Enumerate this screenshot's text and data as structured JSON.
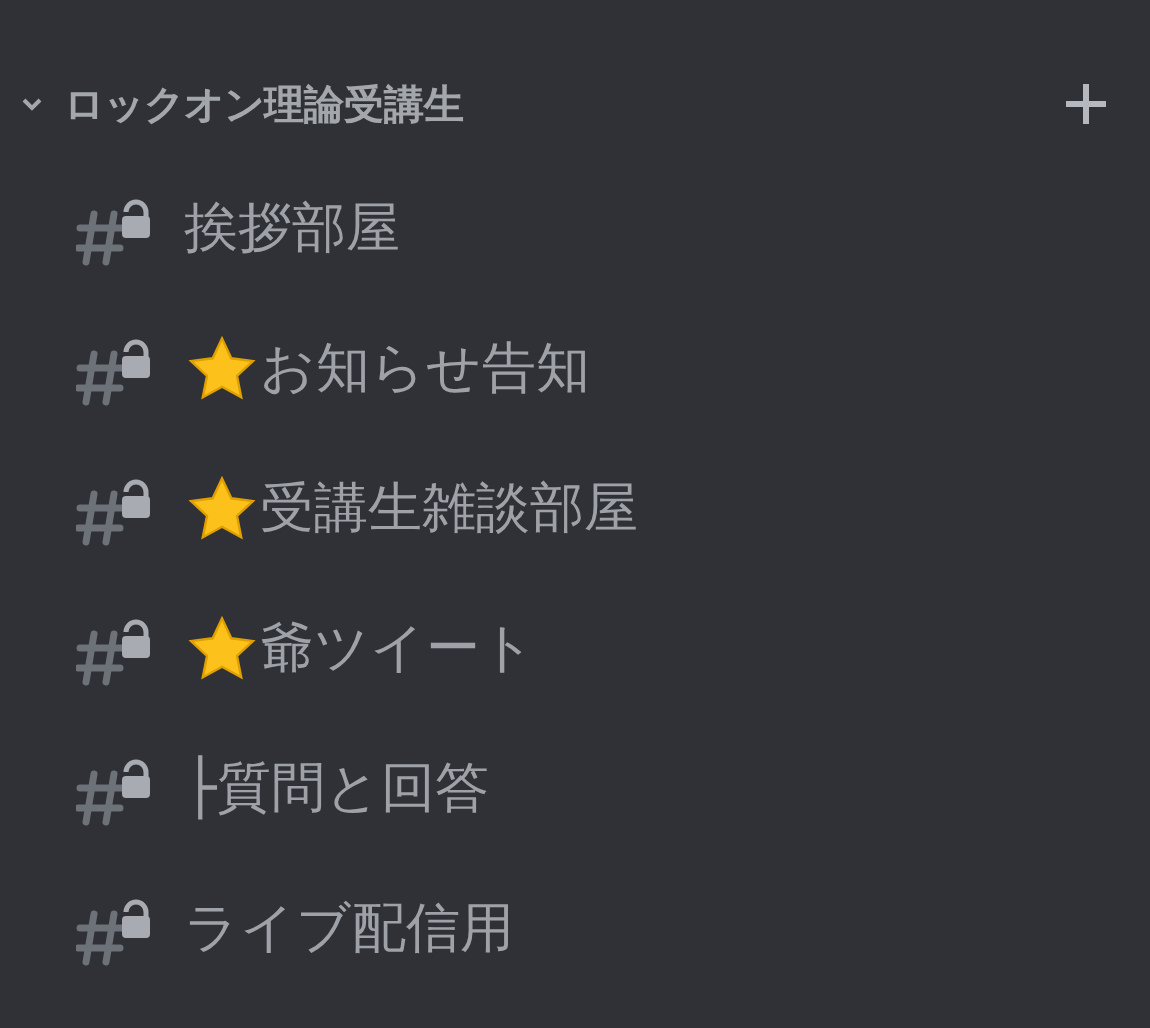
{
  "category": {
    "name": "ロックオン理論受講生",
    "expanded": true
  },
  "channels": [
    {
      "name": "挨拶部屋",
      "starred": false
    },
    {
      "name": "お知らせ告知",
      "starred": true
    },
    {
      "name": "受講生雑談部屋",
      "starred": true
    },
    {
      "name": "爺ツイート",
      "starred": true
    },
    {
      "name": "├質問と回答",
      "starred": false
    },
    {
      "name": "ライブ配信用",
      "starred": false
    }
  ]
}
